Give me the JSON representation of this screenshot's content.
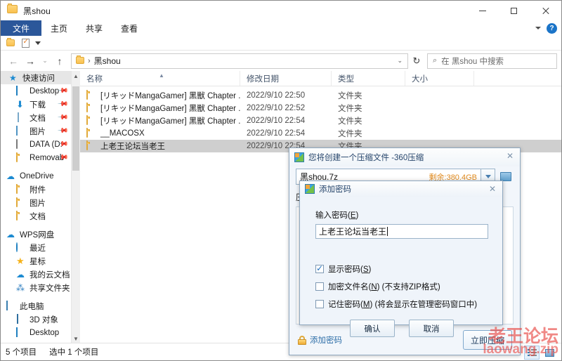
{
  "window": {
    "title": "黑shou",
    "icon": "folder-icon",
    "minimize": "−",
    "maximize": "□",
    "close": "✕"
  },
  "ribbon": {
    "tabs": [
      {
        "label": "文件",
        "active": true
      },
      {
        "label": "主页",
        "active": false
      },
      {
        "label": "共享",
        "active": false
      },
      {
        "label": "查看",
        "active": false
      }
    ],
    "collapse_icon": "chevron-down-icon",
    "help_icon": "help-icon",
    "help_label": "?"
  },
  "quick_access_toolbar": {
    "items": [
      {
        "icon": "folder-icon"
      },
      {
        "icon": "properties-icon"
      }
    ],
    "customize_icon": "chevron-down-icon"
  },
  "navigation": {
    "back_icon": "arrow-left-icon",
    "forward_icon": "arrow-right-icon",
    "recent_icon": "chevron-down-icon",
    "up_icon": "arrow-up-icon",
    "address": {
      "folder_icon": "folder-icon",
      "separator": "›",
      "path": "黑shou",
      "dropdown_icon": "chevron-down-icon"
    },
    "refresh_icon": "refresh-icon",
    "refresh_glyph": "↻",
    "search": {
      "icon": "search-icon",
      "placeholder": "在 黑shou 中搜索"
    }
  },
  "sidebar": {
    "scroll_up_icon": "chevron-up-icon",
    "scroll_down_icon": "chevron-down-icon",
    "groups": [
      {
        "header": {
          "label": "快速访问",
          "icon": "pin-star-icon",
          "selected": true
        },
        "items": [
          {
            "label": "Desktop",
            "icon": "desktop-icon",
            "pinned": true
          },
          {
            "label": "下载",
            "icon": "downloads-icon",
            "pinned": true
          },
          {
            "label": "文档",
            "icon": "documents-icon",
            "pinned": true
          },
          {
            "label": "图片",
            "icon": "pictures-icon",
            "pinned": true
          },
          {
            "label": "DATA (D:",
            "icon": "drive-icon",
            "pinned": true
          },
          {
            "label": "Removab",
            "icon": "folder-icon",
            "pinned": true
          }
        ]
      },
      {
        "header": {
          "label": "OneDrive",
          "icon": "cloud-icon",
          "selected": false
        },
        "items": [
          {
            "label": "附件",
            "icon": "folder-icon",
            "pinned": false
          },
          {
            "label": "图片",
            "icon": "folder-icon",
            "pinned": false
          },
          {
            "label": "文档",
            "icon": "folder-icon",
            "pinned": false
          }
        ]
      },
      {
        "header": {
          "label": "WPS网盘",
          "icon": "cloud-icon",
          "selected": false
        },
        "items": [
          {
            "label": "最近",
            "icon": "clock-icon",
            "pinned": false
          },
          {
            "label": "星标",
            "icon": "star-icon",
            "pinned": false
          },
          {
            "label": "我的云文档",
            "icon": "cloud-icon",
            "pinned": false
          },
          {
            "label": "共享文件夹",
            "icon": "share-icon",
            "pinned": false
          }
        ]
      },
      {
        "header": {
          "label": "此电脑",
          "icon": "this-pc-icon",
          "selected": false
        },
        "items": [
          {
            "label": "3D 对象",
            "icon": "3d-objects-icon",
            "pinned": false
          },
          {
            "label": "Desktop",
            "icon": "desktop-icon",
            "pinned": false
          }
        ]
      }
    ]
  },
  "file_list": {
    "columns": [
      {
        "label": "名称",
        "sorted": true,
        "sort_icon": "caret-up-icon"
      },
      {
        "label": "修改日期",
        "sorted": false
      },
      {
        "label": "类型",
        "sorted": false
      },
      {
        "label": "大小",
        "sorted": false
      }
    ],
    "rows": [
      {
        "name": "[リキッドMangaGamer] 黑獣 Chapter ...",
        "date": "2022/9/10 22:50",
        "type": "文件夹",
        "size": "",
        "icon": "folder-icon",
        "selected": false
      },
      {
        "name": "[リキッドMangaGamer] 黑獣 Chapter ...",
        "date": "2022/9/10 22:52",
        "type": "文件夹",
        "size": "",
        "icon": "folder-icon",
        "selected": false
      },
      {
        "name": "[リキッドMangaGamer] 黑獣 Chapter ...",
        "date": "2022/9/10 22:54",
        "type": "文件夹",
        "size": "",
        "icon": "folder-icon",
        "selected": false
      },
      {
        "name": "__MACOSX",
        "date": "2022/9/10 22:54",
        "type": "文件夹",
        "size": "",
        "icon": "folder-icon",
        "selected": false
      },
      {
        "name": "上老王论坛当老王",
        "date": "2022/9/10 22:54",
        "type": "文件夹",
        "size": "",
        "icon": "folder-icon",
        "selected": true
      }
    ]
  },
  "status_bar": {
    "item_count": "5 个项目",
    "selection": "选中 1 个项目",
    "views": [
      {
        "name": "details-view",
        "icon": "details-view-icon",
        "active": true
      },
      {
        "name": "large-icons-view",
        "icon": "large-icons-view-icon",
        "active": false
      }
    ]
  },
  "compress_dialog": {
    "icon": "360-zip-icon",
    "title": "您将创建一个压缩文件 -360压缩",
    "close_label": "✕",
    "filename": "黑shou.7z",
    "free_space": "剩余:380.4GB",
    "dropdown_icon": "chevron-down-icon",
    "browse_icon": "folder-browse-icon",
    "format_label": "压",
    "footer": {
      "lock_icon": "lock-icon",
      "add_password_label": "添加密码",
      "compress_button": "立即压缩"
    }
  },
  "password_dialog": {
    "icon": "360-zip-icon",
    "title": "添加密码",
    "close_label": "✕",
    "input_label": "输入密码(",
    "input_accel": "E",
    "input_label_end": ")",
    "password_value": "上老王论坛当老王",
    "checkboxes": [
      {
        "label_pre": "显示密码(",
        "accel": "S",
        "label_post": ")",
        "checked": true,
        "name": "show-password-checkbox"
      },
      {
        "label_pre": "加密文件名(",
        "accel": "N",
        "label_post": ") (不支持ZIP格式)",
        "checked": false,
        "name": "encrypt-filename-checkbox"
      },
      {
        "label_pre": "记住密码(",
        "accel": "M",
        "label_post": ") (将会显示在管理密码窗口中)",
        "checked": false,
        "name": "remember-password-checkbox"
      }
    ],
    "ok_button": "确认",
    "cancel_button": "取消"
  },
  "watermark": {
    "cn": "老王论坛",
    "en": "laowang.zip",
    "color": "#e8413c"
  }
}
